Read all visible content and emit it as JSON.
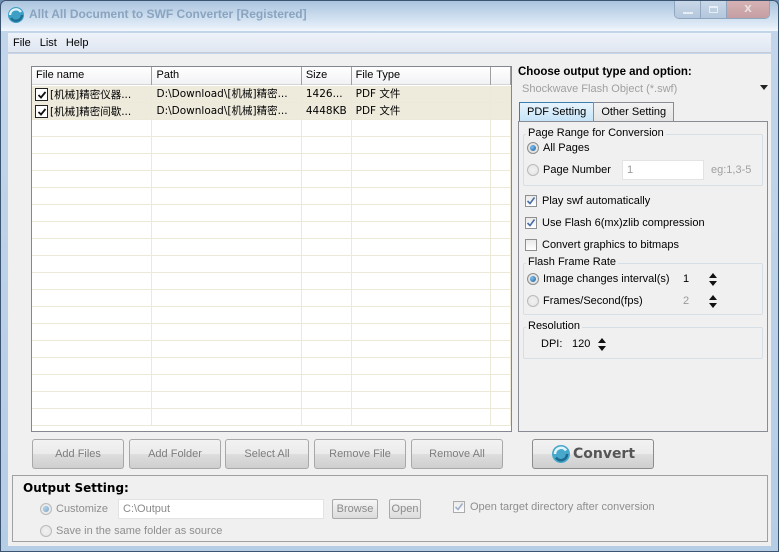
{
  "window": {
    "title": "Allt All Document to SWF Converter [Registered]",
    "controls": {
      "minimize": "—",
      "maximize": "□",
      "close": "X"
    }
  },
  "menu": [
    "File",
    "List",
    "Help"
  ],
  "file_list": {
    "columns": [
      "File name",
      "Path",
      "Size",
      "File Type"
    ],
    "rows": [
      {
        "checked": true,
        "name": "[机械]精密仪器...",
        "path": "D:\\Download\\[机械]精密...",
        "size": "1426...",
        "type": "PDF 文件"
      },
      {
        "checked": true,
        "name": "[机械]精密间歇...",
        "path": "D:\\Download\\[机械]精密...",
        "size": "4448KB",
        "type": "PDF 文件"
      }
    ]
  },
  "list_buttons": {
    "add_files": "Add Files",
    "add_folder": "Add Folder",
    "select_all": "Select All",
    "remove_file": "Remove File",
    "remove_all": "Remove All"
  },
  "convert_button": "Convert",
  "output_type": {
    "label": "Choose output type and option:",
    "selected": "Shockwave Flash Object (*.swf)"
  },
  "tabs": [
    "PDF Setting",
    "Other Setting"
  ],
  "pdf_setting": {
    "page_range": {
      "title": "Page Range for Conversion",
      "all_pages": "All Pages",
      "page_number": "Page Number",
      "page_number_value": "1",
      "page_number_hint": "eg:1,3-5",
      "selected": "all_pages"
    },
    "play_swf": {
      "label": "Play swf automatically",
      "checked": true
    },
    "use_flash6": {
      "label": "Use Flash 6(mx)zlib compression",
      "checked": true
    },
    "convert_bitmaps": {
      "label": "Convert graphics to bitmaps",
      "checked": false
    },
    "frame_rate": {
      "title": "Flash Frame Rate",
      "interval_label": "Image changes interval(s)",
      "interval_value": "1",
      "fps_label": "Frames/Second(fps)",
      "fps_value": "2",
      "selected": "interval"
    },
    "resolution": {
      "title": "Resolution",
      "dpi_label": "DPI:",
      "dpi_value": "120"
    }
  },
  "output_setting": {
    "title": "Output Setting:",
    "customize_label": "Customize",
    "path": "C:\\Output",
    "browse": "Browse",
    "open": "Open",
    "open_after_label": "Open target directory after conversion",
    "open_after_checked": true,
    "same_folder_label": "Save in the same folder as source",
    "selected": "customize"
  }
}
